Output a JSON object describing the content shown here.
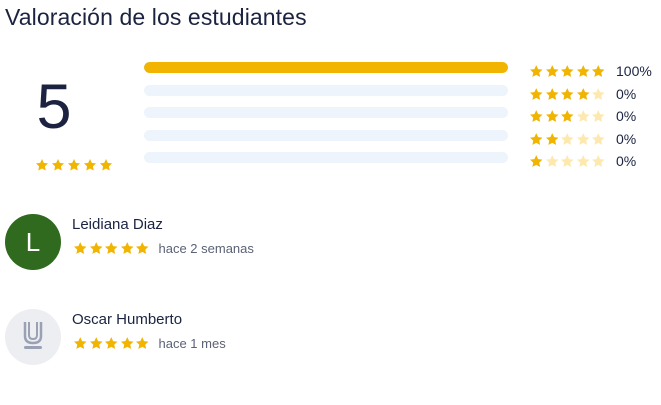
{
  "section": {
    "title": "Valoración de los estudiantes"
  },
  "summary": {
    "average": "5",
    "average_stars": 5
  },
  "distribution": [
    {
      "stars": 5,
      "percent_label": "100%",
      "fraction": 1.0
    },
    {
      "stars": 4,
      "percent_label": "0%",
      "fraction": 0
    },
    {
      "stars": 3,
      "percent_label": "0%",
      "fraction": 0
    },
    {
      "stars": 2,
      "percent_label": "0%",
      "fraction": 0
    },
    {
      "stars": 1,
      "percent_label": "0%",
      "fraction": 0
    }
  ],
  "reviews": [
    {
      "name": "Leidiana Diaz",
      "avatar_letter": "L",
      "avatar_color": "#2f6a1e",
      "stars": 5,
      "time": "hace 2 semanas"
    },
    {
      "name": "Oscar Humberto",
      "avatar_icon": "u-letter-icon",
      "stars": 5,
      "time": "hace 1 mes"
    }
  ],
  "colors": {
    "star_filled": "#f1b400",
    "star_empty": "#fde9b0",
    "bar_track": "#eef4fb",
    "bar_fill": "#f1b400"
  }
}
